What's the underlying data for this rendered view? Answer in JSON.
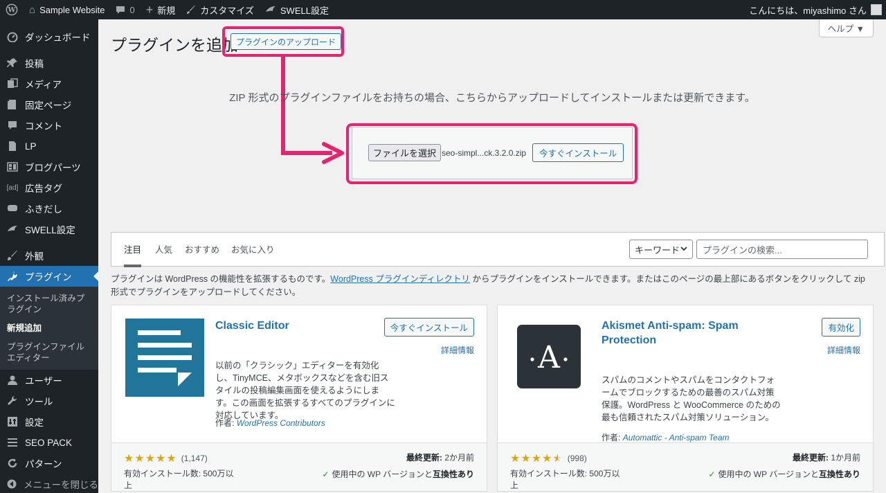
{
  "adminbar": {
    "site_name": "Sample Website",
    "comments_count": "0",
    "new_label": "新規",
    "customize_label": "カスタマイズ",
    "swell_label": "SWELL設定",
    "greeting": "こんにちは、miyashimo さん"
  },
  "sidebar": {
    "items": [
      {
        "label": "ダッシュボード",
        "icon": "dashboard-icon"
      },
      {
        "label": "投稿",
        "icon": "pin-icon"
      },
      {
        "label": "メディア",
        "icon": "media-icon"
      },
      {
        "label": "固定ページ",
        "icon": "page-icon"
      },
      {
        "label": "コメント",
        "icon": "comment-icon"
      },
      {
        "label": "LP",
        "icon": "lp-icon"
      },
      {
        "label": "ブログパーツ",
        "icon": "blog-parts-icon"
      },
      {
        "label": "広告タグ",
        "icon": "ad-icon",
        "icon_text": "[ad]"
      },
      {
        "label": "ふきだし",
        "icon": "balloon-icon"
      },
      {
        "label": "SWELL設定",
        "icon": "swell-icon"
      },
      {
        "label": "外観",
        "icon": "brush-icon"
      },
      {
        "label": "プラグイン",
        "icon": "plugin-icon"
      },
      {
        "label": "ユーザー",
        "icon": "user-icon"
      },
      {
        "label": "ツール",
        "icon": "wrench-icon"
      },
      {
        "label": "設定",
        "icon": "settings-icon"
      },
      {
        "label": "SEO PACK",
        "icon": "seo-pack-icon"
      },
      {
        "label": "パターン",
        "icon": "pattern-icon"
      },
      {
        "label": "メニューを閉じる",
        "icon": "collapse-icon"
      }
    ],
    "submenu": [
      {
        "label": "インストール済みプラグイン"
      },
      {
        "label": "新規追加"
      },
      {
        "label": "プラグインファイルエディター"
      }
    ]
  },
  "main": {
    "title": "プラグインを追加",
    "upload_button": "プラグインのアップロード",
    "help_label": "ヘルプ ▼",
    "upload_description": "ZIP 形式のプラグインファイルをお持ちの場合、こちらからアップロードしてインストールまたは更新できます。",
    "file_button": "ファイルを選択",
    "file_name": "seo-simpl...ck.3.2.0.zip",
    "install_now": "今すぐインストール"
  },
  "filter": {
    "tabs": [
      "注目",
      "人気",
      "おすすめ",
      "お気に入り"
    ],
    "search_type": "キーワード",
    "search_placeholder": "プラグインの検索..."
  },
  "intro": {
    "text_before": "プラグインは WordPress の機能性を拡張するものです。",
    "link_text": "WordPress プラグインディレクトリ",
    "text_after": " からプラグインをインストールできます。またはこのページの最上部にあるボタンをクリックして zip 形式でプラグインをアップロードしてください。"
  },
  "plugins": [
    {
      "name": "Classic Editor",
      "description": "以前の「クラシック」エディターを有効化し、TinyMCE、メタボックスなどを含む旧スタイルの投稿編集画面を使えるようにします。この画面を拡張するすべてのプラグインに対応しています。",
      "author_label": "作者:",
      "author": "WordPress Contributors",
      "action": "今すぐインストール",
      "details": "詳細情報",
      "rating": 5,
      "rating_count": "(1,147)",
      "installs": "有効インストール数: 500万以上",
      "last_updated_label": "最終更新:",
      "last_updated": "2か月前",
      "compat_text": "使用中の WP バージョンと",
      "compat_bold": "互換性あり"
    },
    {
      "name": "Akismet Anti-spam: Spam Protection",
      "description": "スパムのコメントやスパムをコンタクトフォームでブロックするための最善のスパム対策保護。WordPress と WooCommerce のための最も信頼されたスパム対策ソリューション。",
      "author_label": "作者:",
      "author": "Automattic - Anti-spam Team",
      "action": "有効化",
      "details": "詳細情報",
      "rating": 4.5,
      "rating_count": "(998)",
      "installs": "有効インストール数: 500万以上",
      "last_updated_label": "最終更新:",
      "last_updated": "1か月前",
      "compat_text": "使用中の WP バージョンと",
      "compat_bold": "互換性あり"
    }
  ],
  "colors": {
    "admin_dark": "#1d2327",
    "accent_blue": "#2271b1",
    "highlight_pink": "#e6236f",
    "star_gold": "#dba617"
  }
}
